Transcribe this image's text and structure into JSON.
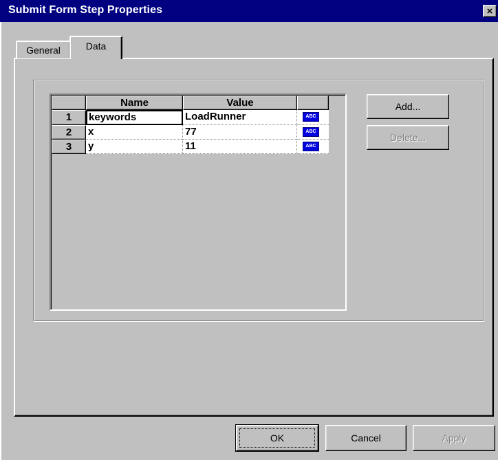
{
  "window": {
    "title": "Submit Form Step Properties",
    "close_glyph": "×"
  },
  "tabs": [
    {
      "label": "General",
      "active": false
    },
    {
      "label": "Data",
      "active": true
    }
  ],
  "grid": {
    "columns": [
      "Name",
      "Value"
    ],
    "rows": [
      {
        "num": "1",
        "name": "keywords",
        "value": "LoadRunner",
        "type_icon": "abc-text-icon"
      },
      {
        "num": "2",
        "name": "x",
        "value": "77",
        "type_icon": "abc-text-icon"
      },
      {
        "num": "3",
        "name": "y",
        "value": "11",
        "type_icon": "abc-text-icon"
      }
    ],
    "type_icon_text": "ABC"
  },
  "side_buttons": {
    "add": {
      "label": "Add...",
      "enabled": true
    },
    "delete": {
      "label": "Delete...",
      "enabled": false
    }
  },
  "footer_buttons": {
    "ok": {
      "label": "OK",
      "enabled": true
    },
    "cancel": {
      "label": "Cancel",
      "enabled": true
    },
    "apply": {
      "label": "Apply",
      "enabled": false
    }
  }
}
